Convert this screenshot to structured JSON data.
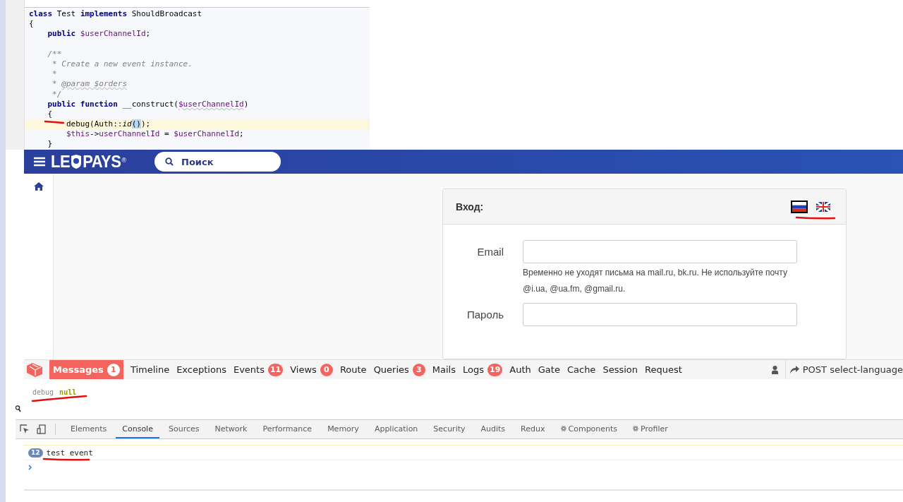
{
  "editor": {
    "lines": [
      {
        "highlighted": false,
        "tokens": [
          {
            "kind": "kw",
            "text": "class "
          },
          {
            "kind": "plain",
            "text": "Test "
          },
          {
            "kind": "kw",
            "text": "implements "
          },
          {
            "kind": "plain",
            "text": "ShouldBroadcast"
          }
        ]
      },
      {
        "highlighted": false,
        "tokens": [
          {
            "kind": "plain",
            "text": "{"
          }
        ]
      },
      {
        "highlighted": false,
        "tokens": [
          {
            "kind": "kw",
            "text": "    public "
          },
          {
            "kind": "var",
            "text": "$userChannelId"
          },
          {
            "kind": "plain",
            "text": ";"
          }
        ]
      },
      {
        "highlighted": false
      },
      {
        "highlighted": false,
        "tokens": [
          {
            "kind": "comment",
            "text": "    /**"
          }
        ]
      },
      {
        "highlighted": false,
        "tokens": [
          {
            "kind": "comment",
            "text": "     * Create a new event instance."
          }
        ]
      },
      {
        "highlighted": false,
        "tokens": [
          {
            "kind": "comment",
            "text": "     *"
          }
        ]
      },
      {
        "highlighted": false,
        "tokens": [
          {
            "kind": "comment",
            "text": "     * "
          },
          {
            "kind": "comment",
            "text": "@param $orders",
            "squiggle": true
          }
        ]
      },
      {
        "highlighted": false,
        "tokens": [
          {
            "kind": "comment",
            "text": "     */"
          }
        ]
      },
      {
        "highlighted": false,
        "tokens": [
          {
            "kind": "kw",
            "text": "    public function "
          },
          {
            "kind": "plain",
            "text": "__construct("
          },
          {
            "kind": "var",
            "text": "$userChannelId",
            "squiggle": true
          },
          {
            "kind": "plain",
            "text": ")"
          }
        ]
      },
      {
        "highlighted": false,
        "tokens": [
          {
            "kind": "plain",
            "text": "    {"
          }
        ]
      },
      {
        "highlighted": true,
        "tokens": [
          {
            "kind": "plain",
            "text": "        debug(Auth::"
          },
          {
            "kind": "italic",
            "text": "id"
          },
          {
            "kind": "sel",
            "text": "()"
          },
          {
            "kind": "plain",
            "text": ");"
          }
        ]
      },
      {
        "highlighted": false,
        "tokens": [
          {
            "kind": "var",
            "text": "        $this"
          },
          {
            "kind": "plain",
            "text": "->"
          },
          {
            "kind": "var",
            "text": "userChannelId"
          },
          {
            "kind": "plain",
            "text": " = "
          },
          {
            "kind": "var",
            "text": "$userChannelId"
          },
          {
            "kind": "plain",
            "text": ";"
          }
        ]
      },
      {
        "highlighted": false,
        "tokens": [
          {
            "kind": "plain",
            "text": "    }"
          }
        ]
      }
    ]
  },
  "site": {
    "logo": {
      "left": "LE",
      "right": "PAYS",
      "mark": "®"
    },
    "search": {
      "placeholder": "Поиск"
    },
    "login": {
      "title": "Вход:",
      "languages": [
        {
          "selected": true,
          "kind": "ru"
        },
        {
          "selected": false,
          "kind": "uk"
        }
      ],
      "email_label": "Email",
      "email_help": "Временно не уходят письма на mail.ru, bk.ru. Не используйте почту @i.ua, @ua.fm, @gmail.ru.",
      "password_label": "Пароль"
    }
  },
  "debugbar": {
    "tabs": [
      {
        "label": "Messages",
        "badge": "1",
        "selected": true
      },
      {
        "label": "Timeline",
        "selected": false
      },
      {
        "label": "Exceptions",
        "selected": false
      },
      {
        "label": "Events",
        "badge": "11",
        "selected": false
      },
      {
        "label": "Views",
        "badge": "0",
        "selected": false
      },
      {
        "label": "Route",
        "selected": false
      },
      {
        "label": "Queries",
        "badge": "3",
        "selected": false
      },
      {
        "label": "Mails",
        "selected": false
      },
      {
        "label": "Logs",
        "badge": "19",
        "selected": false
      },
      {
        "label": "Auth",
        "selected": false
      },
      {
        "label": "Gate",
        "selected": false
      },
      {
        "label": "Cache",
        "selected": false
      },
      {
        "label": "Session",
        "selected": false
      },
      {
        "label": "Request",
        "selected": false
      }
    ],
    "request": "POST select-language",
    "message": {
      "label": "debug",
      "value": "null"
    }
  },
  "devtools": {
    "tabs": [
      {
        "label": "Elements",
        "selected": false
      },
      {
        "label": "Console",
        "selected": true
      },
      {
        "label": "Sources",
        "selected": false
      },
      {
        "label": "Network",
        "selected": false
      },
      {
        "label": "Performance",
        "selected": false
      },
      {
        "label": "Memory",
        "selected": false
      },
      {
        "label": "Application",
        "selected": false
      },
      {
        "label": "Security",
        "selected": false
      },
      {
        "label": "Audits",
        "selected": false
      },
      {
        "label": "Redux",
        "selected": false
      },
      {
        "label": "Components",
        "kind": "react",
        "selected": false
      },
      {
        "label": "Profiler",
        "kind": "react",
        "selected": false
      }
    ],
    "console": [
      {
        "count": "12",
        "text": "test event"
      }
    ]
  }
}
